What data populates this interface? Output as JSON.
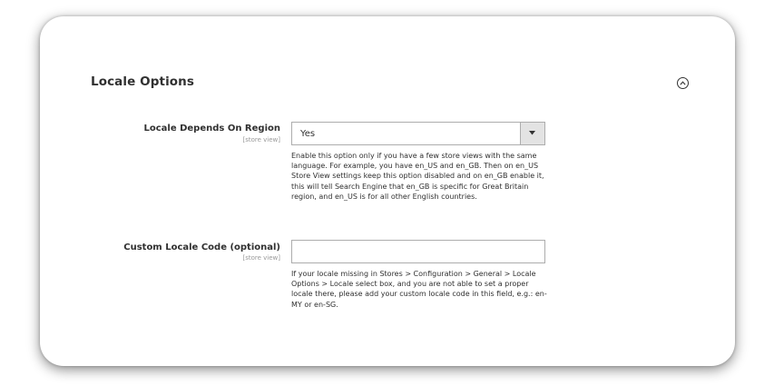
{
  "section": {
    "title": "Locale Options",
    "collapse_icon": "chevron-up-circle-icon"
  },
  "fields": {
    "locale_depends_on_region": {
      "label": "Locale Depends On Region",
      "scope": "[store view]",
      "value": "Yes",
      "note": "Enable this option only if you have a few store views with the same language. For example, you have en_US and en_GB. Then on en_US Store View settings keep this option disabled and on en_GB enable it, this will tell Search Engine that en_GB is specific for Great Britain region, and en_US is for all other English countries."
    },
    "custom_locale_code": {
      "label": "Custom Locale Code (optional)",
      "scope": "[store view]",
      "value": "",
      "note": "If your locale missing in Stores > Configuration > General > Locale Options > Locale select box, and you are not able to set a proper locale there, please add your custom locale code in this field, e.g.: en-MY or en-SG."
    }
  }
}
